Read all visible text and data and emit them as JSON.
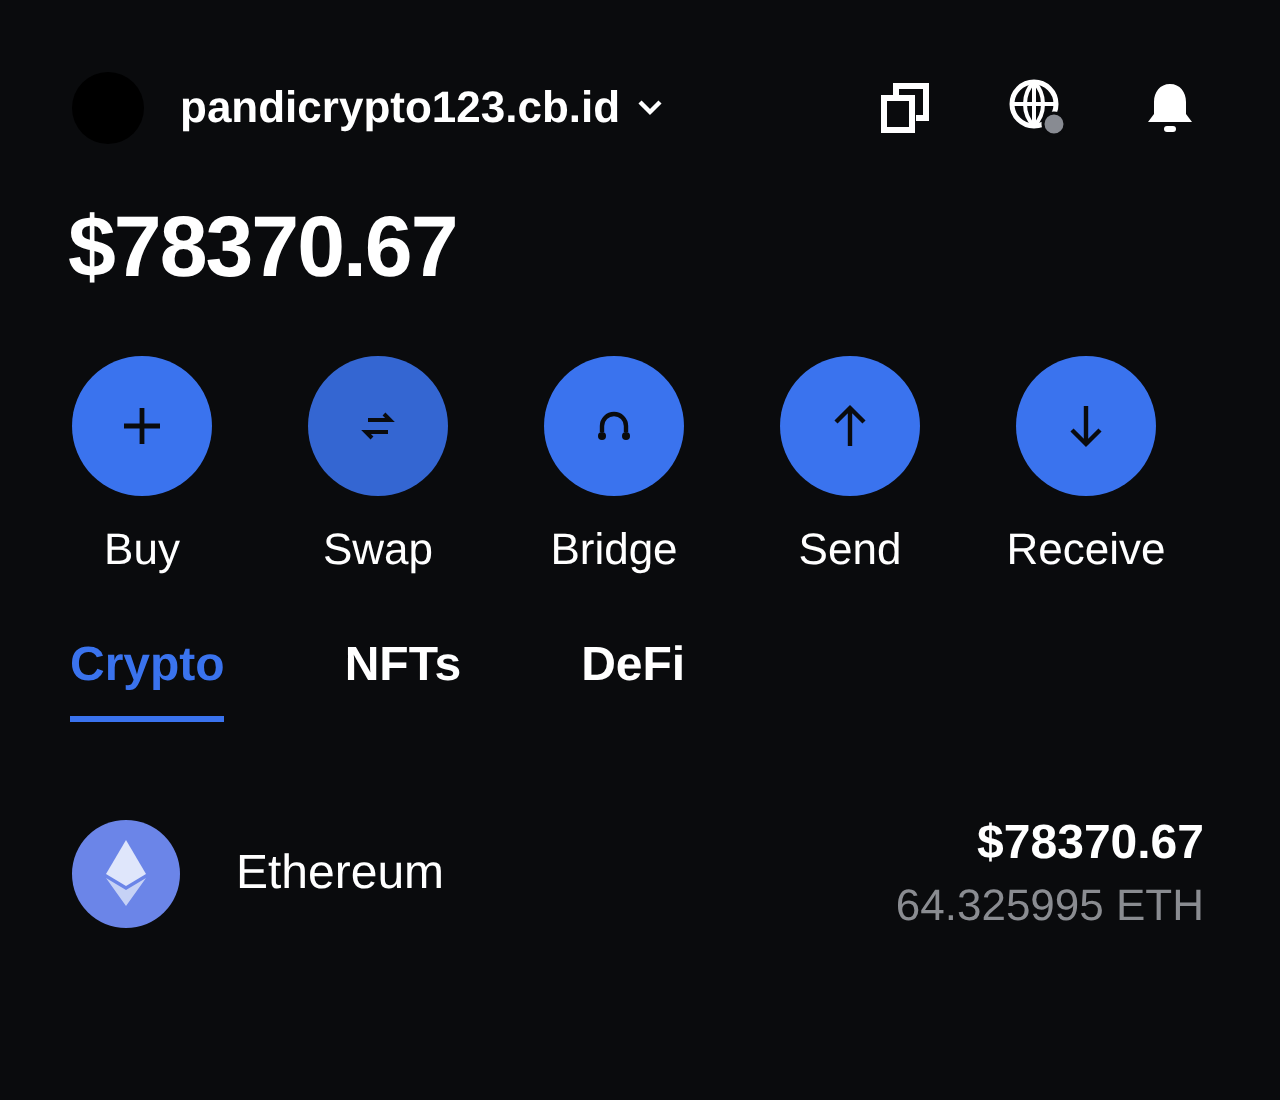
{
  "header": {
    "account": "pandicrypto123.cb.id"
  },
  "balance": "$78370.67",
  "actions": [
    {
      "kind": "buy",
      "label": "Buy"
    },
    {
      "kind": "swap",
      "label": "Swap"
    },
    {
      "kind": "bridge",
      "label": "Bridge"
    },
    {
      "kind": "send",
      "label": "Send"
    },
    {
      "kind": "receive",
      "label": "Receive"
    }
  ],
  "tabs": [
    {
      "label": "Crypto",
      "selected": true
    },
    {
      "label": "NFTs",
      "selected": false
    },
    {
      "label": "DeFi",
      "selected": false
    }
  ],
  "assets": [
    {
      "name": "Ethereum",
      "value": "$78370.67",
      "amount": "64.325995 ETH"
    }
  ]
}
